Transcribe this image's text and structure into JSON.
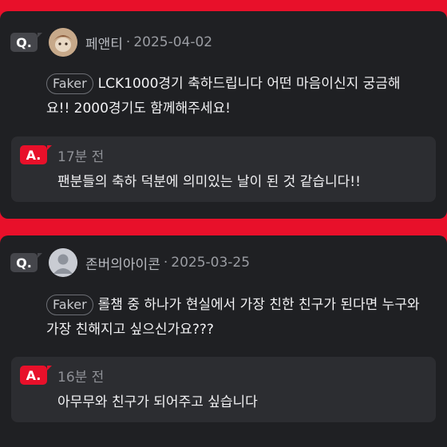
{
  "questions": [
    {
      "badge": "Q.",
      "author": "페앤티",
      "separator": "·",
      "date": "2025-04-02",
      "tag": "Faker",
      "text": "LCK1000경기 축하드립니다 어떤 마음이신지 궁금해요!! 2000경기도 함께해주세요!",
      "answer": {
        "badge": "A.",
        "time": "17분 전",
        "text": "팬분들의 축하 덕분에 의미있는 날이 된 것 같습니다!!"
      }
    },
    {
      "badge": "Q.",
      "author": "존버의아이콘",
      "separator": "·",
      "date": "2025-03-25",
      "tag": "Faker",
      "text": "롤챔 중 하나가 현실에서 가장 친한 친구가 된다면 누구와 가장 친해지고 싶으신가요???",
      "answer": {
        "badge": "A.",
        "time": "16분 전",
        "text": "아무무와 친구가 되어주고 싶습니다"
      }
    }
  ]
}
